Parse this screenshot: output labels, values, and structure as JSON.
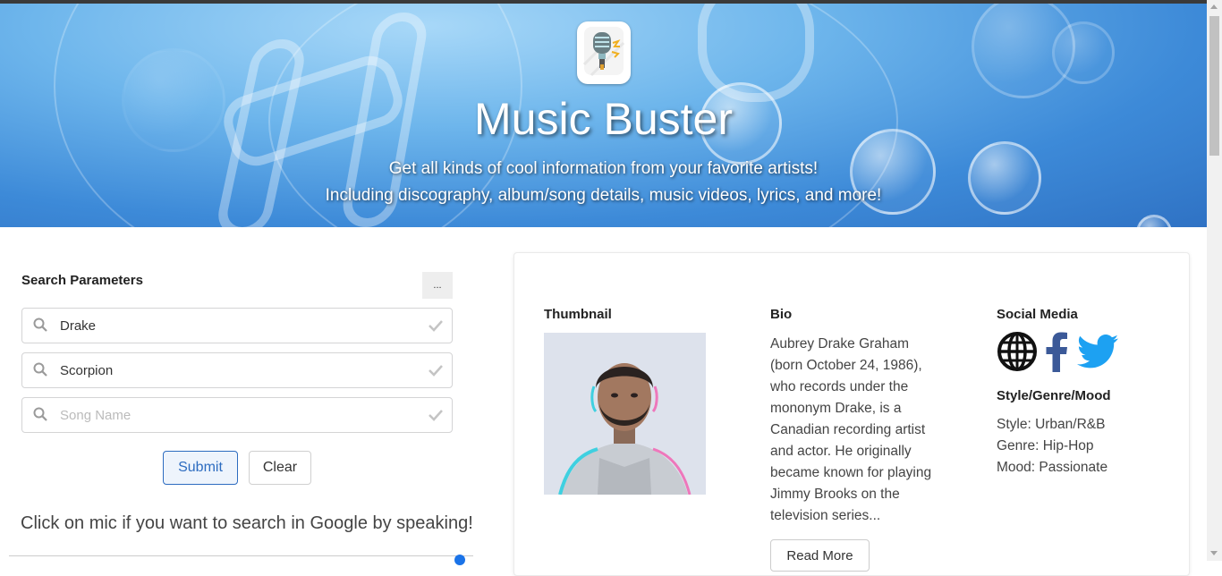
{
  "hero": {
    "title": "Music Buster",
    "subtitle_line1": "Get all kinds of cool information from your favorite artists!",
    "subtitle_line2": "Including discography, album/song details, music videos, lyrics, and more!",
    "logo_icon": "microphone-icon"
  },
  "search": {
    "title": "Search Parameters",
    "more_label": "...",
    "artist_value": "Drake",
    "album_value": "Scorpion",
    "song_placeholder": "Song Name",
    "submit_label": "Submit",
    "clear_label": "Clear",
    "mic_prompt": "Click on mic if you want to search in Google by speaking!"
  },
  "artist": {
    "thumbnail_title": "Thumbnail",
    "bio_title": "Bio",
    "bio_text": "Aubrey Drake Graham (born October 24, 1986), who records under the mononym Drake, is a Canadian recording artist and actor. He originally became known for playing Jimmy Brooks on the television series...",
    "read_more_label": "Read More",
    "social_title": "Social Media",
    "social_icons": [
      "globe-icon",
      "facebook-icon",
      "twitter-icon"
    ],
    "style_title": "Style/Genre/Mood",
    "style": "Style: Urban/R&B",
    "genre": "Genre: Hip-Hop",
    "mood": "Mood: Passionate"
  },
  "colors": {
    "accent": "#2d6cc0",
    "facebook": "#3b5998",
    "twitter": "#1da1f2"
  }
}
